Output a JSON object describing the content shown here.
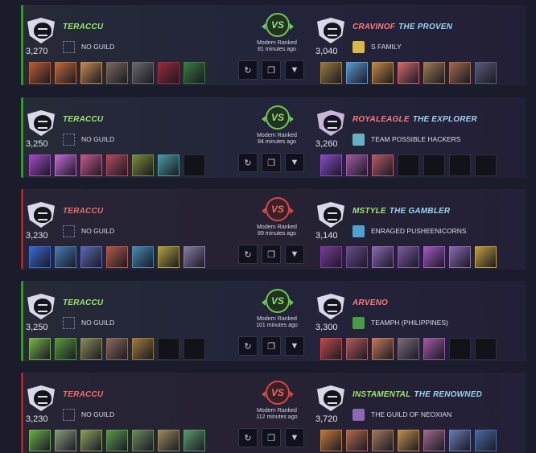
{
  "matches": [
    {
      "result": "win",
      "left": {
        "name": "TERACCU",
        "title": "",
        "guild": "NO GUILD",
        "rating": "3,270",
        "team": [
          "#b85c2f",
          "#c06a3a",
          "#c08a50",
          "#7a6a5a",
          "#6a6a6a",
          "#9a2a3a",
          "#3a7a3a"
        ],
        "empties": 0
      },
      "mode_line1": "Modern Ranked",
      "mode_line2": "81 minutes ago",
      "right": {
        "name": "CRAVINOF",
        "title": "THE PROVEN",
        "guild": "S FAMILY",
        "rating": "3,040",
        "team": [
          "#9a7a3a",
          "#5a9ad0",
          "#c08a40",
          "#d06a6a",
          "#a07a50",
          "#a06a4a",
          "#5a5a7a"
        ],
        "empties": 0
      }
    },
    {
      "result": "win",
      "left": {
        "name": "TERACCU",
        "title": "",
        "guild": "NO GUILD",
        "rating": "3,250",
        "team": [
          "#a04ac0",
          "#c06ad0",
          "#c05a8a",
          "#b04a5a",
          "#7a8a3a",
          "#4a9aa0"
        ],
        "empties": 1
      },
      "mode_line1": "Modern Ranked",
      "mode_line2": "84 minutes ago",
      "right": {
        "name": "ROYALEAGLE",
        "title": "THE EXPLORER",
        "guild": "TEAM POSSIBLE HACKERS",
        "rating": "3,260",
        "team": [
          "#8a4ac0",
          "#a05aa0",
          "#b05a6a"
        ],
        "empties": 4
      }
    },
    {
      "result": "loss",
      "left": {
        "name": "TERACCU",
        "title": "",
        "guild": "NO GUILD",
        "rating": "3,230",
        "team": [
          "#3a6ad0",
          "#4a7ab0",
          "#5a6ab0",
          "#b05a4a",
          "#4a8ab0",
          "#b0a040",
          "#8a7aa0"
        ],
        "empties": 0
      },
      "mode_line1": "Modern Ranked",
      "mode_line2": "89 minutes ago",
      "right": {
        "name": "MSTYLE",
        "title": "THE GAMBLER",
        "guild": "ENRAGED PUSHEENICORNS",
        "rating": "3,140",
        "team": [
          "#7a3a9a",
          "#6a4a8a",
          "#8a6ab0",
          "#7a5aa0",
          "#a05ac0",
          "#8a6ab0",
          "#c0a040"
        ],
        "empties": 0
      }
    },
    {
      "result": "win",
      "left": {
        "name": "TERACCU",
        "title": "",
        "guild": "NO GUILD",
        "rating": "3,250",
        "team": [
          "#7ab04a",
          "#5a9a3a",
          "#8a8a5a",
          "#8a6a5a",
          "#a07a3a"
        ],
        "empties": 2
      },
      "mode_line1": "Modern Ranked",
      "mode_line2": "101 minutes ago",
      "right": {
        "name": "ARVENO",
        "title": "",
        "guild": "TEAMPH (PHILIPPINES)",
        "rating": "3,300",
        "team": [
          "#c04a4a",
          "#b05a5a",
          "#c07a5a",
          "#7a6a7a",
          "#a05aa0"
        ],
        "empties": 2
      }
    },
    {
      "result": "loss",
      "left": {
        "name": "TERACCU",
        "title": "",
        "guild": "NO GUILD",
        "rating": "3,230",
        "team": [
          "#6ab04a",
          "#8a9a7a",
          "#8aa05a",
          "#5a9a4a",
          "#6a8a5a",
          "#9a8a5a",
          "#5a9a6a"
        ],
        "empties": 0
      },
      "mode_line1": "Modern Ranked",
      "mode_line2": "112 minutes ago",
      "right": {
        "name": "INSTAMENTAL",
        "title": "THE RENOWNED",
        "guild": "THE GUILD OF NEOXIAN",
        "rating": "3,720",
        "team": [
          "#c07a3a",
          "#b06a4a",
          "#a07a5a",
          "#c0904a",
          "#a06a8a",
          "#6a7ab0",
          "#4a6aa0"
        ],
        "empties": 0
      }
    }
  ],
  "icons": {
    "rematch": "refresh-icon",
    "copy": "copy-icon",
    "expand": "chevron-down-icon",
    "vs": "vs-badge"
  },
  "colors": {
    "win_accent": "#6ec55a",
    "loss_accent": "#d04848",
    "player_name_win": "#9be86a",
    "player_name_loss": "#f06c6c",
    "title_text": "#9bd3ee",
    "background": "#1b1c2b"
  },
  "guild_icon_colors": {
    "1": "#d8b84a",
    "2": "#6ab0c0",
    "3": "#50a0d0",
    "4": "#4a9a4a",
    "5": "#8a6ab0"
  }
}
